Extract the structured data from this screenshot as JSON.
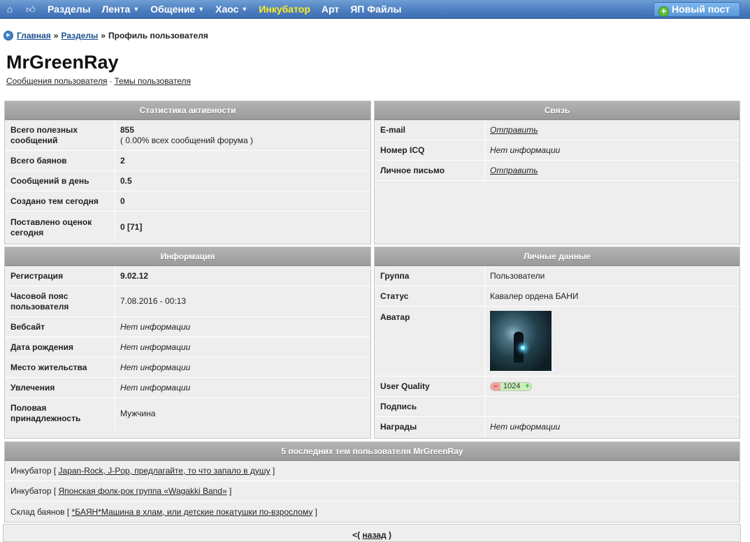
{
  "nav": {
    "home_icon": "home-icon",
    "like_icon": "thumbs-up-icon",
    "items": [
      {
        "label": "Разделы",
        "dropdown": false,
        "active": false
      },
      {
        "label": "Лента",
        "dropdown": true,
        "active": false
      },
      {
        "label": "Общение",
        "dropdown": true,
        "active": false
      },
      {
        "label": "Хаос",
        "dropdown": true,
        "active": false
      },
      {
        "label": "Инкубатор",
        "dropdown": false,
        "active": true
      },
      {
        "label": "Арт",
        "dropdown": false,
        "active": false
      },
      {
        "label": "ЯП Файлы",
        "dropdown": false,
        "active": false
      }
    ],
    "new_post": "Новый пост",
    "active_color": "#ffee22",
    "bar_color": "#4a7cbf"
  },
  "breadcrumb": {
    "home": "Главная",
    "sections": "Разделы",
    "current": "Профиль пользователя",
    "separator": "»"
  },
  "user": {
    "name": "MrGreenRay",
    "link_posts": "Сообщения пользователя",
    "link_topics": "Темы пользователя",
    "link_sep": "·"
  },
  "stats": {
    "title": "Статистика активности",
    "rows": [
      {
        "key": "Всего полезных сообщений",
        "value": "855",
        "sub": "( 0.00% всех сообщений форума )"
      },
      {
        "key": "Всего баянов",
        "value": "2"
      },
      {
        "key": "Сообщений в день",
        "value": "0.5"
      },
      {
        "key": "Создано тем сегодня",
        "value": "0"
      },
      {
        "key": "Поставлено оценок сегодня",
        "value": "0 [71]"
      }
    ]
  },
  "contact": {
    "title": "Связь",
    "rows": [
      {
        "key": "E-mail",
        "value": "Отправить"
      },
      {
        "key": "Номер ICQ",
        "value": "Нет информации"
      },
      {
        "key": "Личное письмо",
        "value": "Отправить"
      }
    ]
  },
  "info": {
    "title": "Информация",
    "rows": [
      {
        "key": "Регистрация",
        "value": "9.02.12"
      },
      {
        "key": "Часовой пояс пользователя",
        "value": "7.08.2016 - 00:13"
      },
      {
        "key": "Вебсайт",
        "value": "Нет информации"
      },
      {
        "key": "Дата рождения",
        "value": "Нет информации"
      },
      {
        "key": "Место жительства",
        "value": "Нет информации"
      },
      {
        "key": "Увлечения",
        "value": "Нет информации"
      },
      {
        "key": "Половая принадлежность",
        "value": "Мужчина"
      }
    ]
  },
  "personal": {
    "title": "Личные данные",
    "rows": [
      {
        "key": "Группа",
        "value": "Пользователи"
      },
      {
        "key": "Статус",
        "value": "Кавалер ордена БАНИ"
      },
      {
        "key": "Аватар",
        "value": ""
      },
      {
        "key": "User Quality",
        "value": "1024",
        "minus": "–",
        "plus": "+"
      },
      {
        "key": "Подпись",
        "value": ""
      },
      {
        "key": "Награды",
        "value": "Нет информации"
      }
    ]
  },
  "topics": {
    "title": "5 последних тем пользователя MrGreenRay",
    "items": [
      {
        "section": "Инкубатор",
        "topic": "Japan-Rock, J-Pop, предлагайте, то что запало в душу"
      },
      {
        "section": "Инкубатор",
        "topic": "Японская фолк-рок группа «Wagakki Band»"
      },
      {
        "section": "Склад баянов",
        "topic": "*БАЯН*Машина в хлам, или детские покатушки по-взрослому"
      }
    ]
  },
  "back": {
    "prefix": "<(",
    "label": "назад",
    "suffix": ")"
  }
}
